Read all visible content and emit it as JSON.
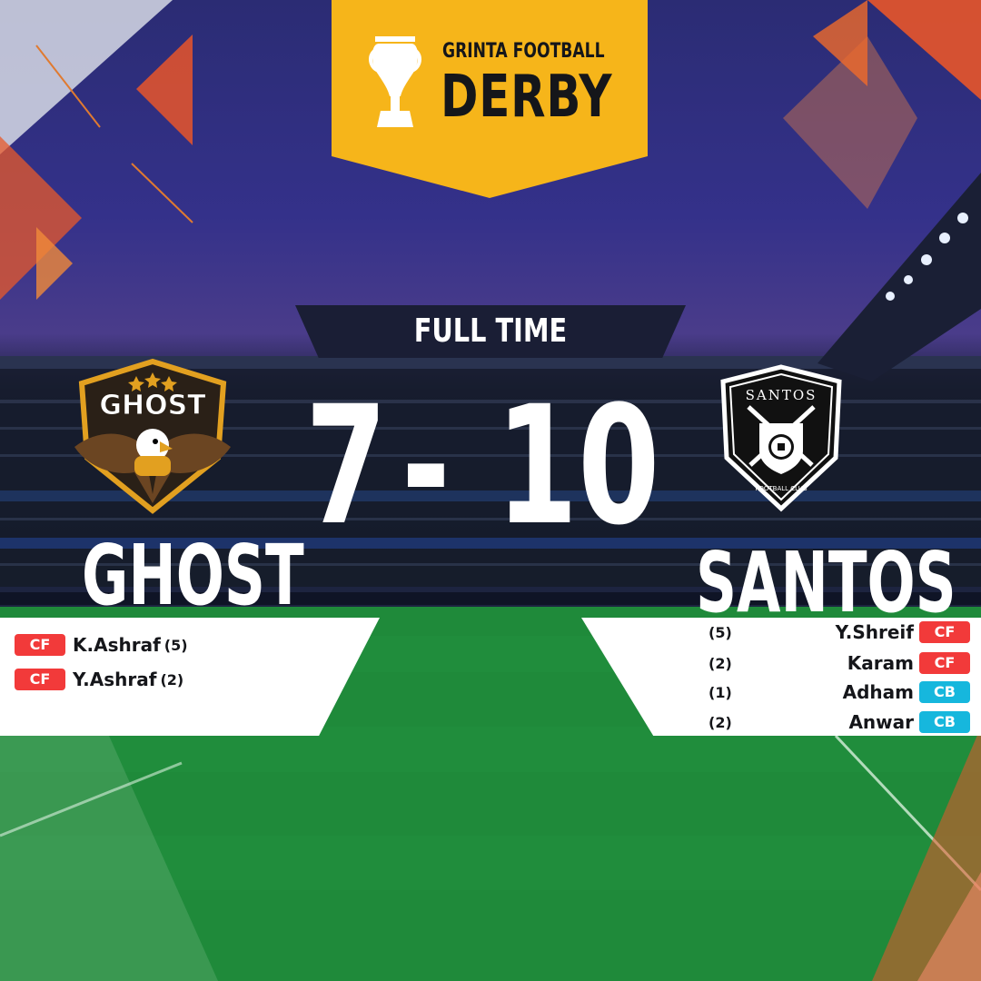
{
  "header": {
    "subtitle": "GRINTA FOOTBALL",
    "title": "DERBY"
  },
  "status": "FULL TIME",
  "score": {
    "home": "7",
    "separator": "-",
    "away": "10"
  },
  "home_team": {
    "name": "GHOST",
    "crest_text": "GHOST",
    "scorers": [
      {
        "position": "CF",
        "name": "K.Ashraf",
        "goals": "(5)"
      },
      {
        "position": "CF",
        "name": "Y.Ashraf",
        "goals": "(2)"
      }
    ]
  },
  "away_team": {
    "name": "SANTOS",
    "crest_text": "SANTOS",
    "crest_subtext": "FOOTBALL CLUB",
    "scorers": [
      {
        "position": "CF",
        "name": "Y.Shreif",
        "goals": "(5)"
      },
      {
        "position": "CF",
        "name": "Karam",
        "goals": "(2)"
      },
      {
        "position": "CB",
        "name": "Adham",
        "goals": "(1)"
      },
      {
        "position": "CB",
        "name": "Anwar",
        "goals": "(2)"
      }
    ]
  },
  "colors": {
    "banner": "#f6b51a",
    "cf_badge": "#f23a3a",
    "cb_badge": "#16b7dd",
    "status_bar": "#1a1e35"
  }
}
